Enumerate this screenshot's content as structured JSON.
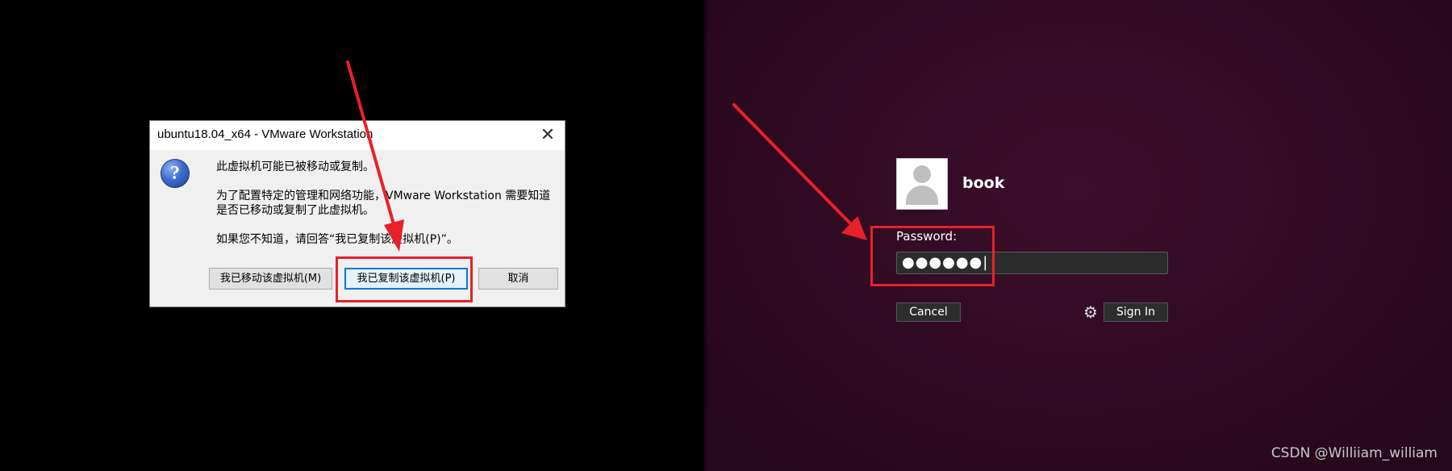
{
  "dialog": {
    "title": "ubuntu18.04_x64 - VMware Workstation",
    "close_symbol": "✕",
    "icon": "question-icon",
    "message_heading": "此虚拟机可能已被移动或复制。",
    "message_body": "为了配置特定的管理和网络功能，VMware Workstation 需要知道是否已移动或复制了此虚拟机。",
    "message_hint": "如果您不知道，请回答“我已复制该虚拟机(P)”。",
    "buttons": {
      "moved": "我已移动该虚拟机(M)",
      "copied": "我已复制该虚拟机(P)",
      "cancel": "取消"
    }
  },
  "login": {
    "avatar": "user-avatar-icon",
    "username": "book",
    "password_label": "Password:",
    "password_value": "●●●●●●|",
    "cancel_label": "Cancel",
    "sign_in_label": "Sign In",
    "settings_icon": "gear-icon"
  },
  "annotation_color": "#e8202a",
  "watermark": "CSDN @Williiam_william"
}
